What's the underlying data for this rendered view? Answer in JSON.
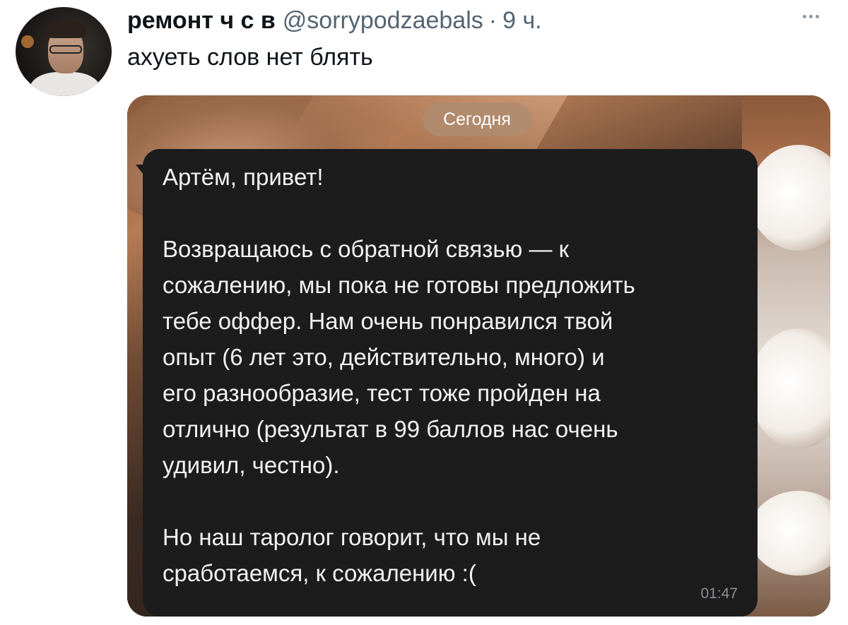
{
  "tweet": {
    "display_name": "ремонт ч с в",
    "handle": "@sorrypodzaebals",
    "separator": "·",
    "time": "9 ч.",
    "text": "ахуеть слов нет блять",
    "more_label": "More options"
  },
  "screenshot": {
    "date_label": "Сегодня",
    "message": {
      "lines": [
        "Артём, привет!",
        "",
        "Возвращаюсь с обратной связью — к",
        "сожалению, мы пока не готовы предложить",
        "тебе оффер. Нам очень понравился твой",
        "опыт (6 лет это, действительно, много) и",
        "его разнообразие, тест тоже пройден на",
        "отлично (результат в 99 баллов нас очень",
        "удивил, честно).",
        "",
        "Но наш таролог говорит, что мы не",
        "сработаемся, к сожалению :("
      ],
      "time": "01:47"
    }
  },
  "colors": {
    "text_primary": "#0f1419",
    "text_secondary": "#536471",
    "bubble_bg": "#1c1c1d",
    "bubble_text": "#f2f2f2",
    "pill_bg": "#af8c70"
  }
}
